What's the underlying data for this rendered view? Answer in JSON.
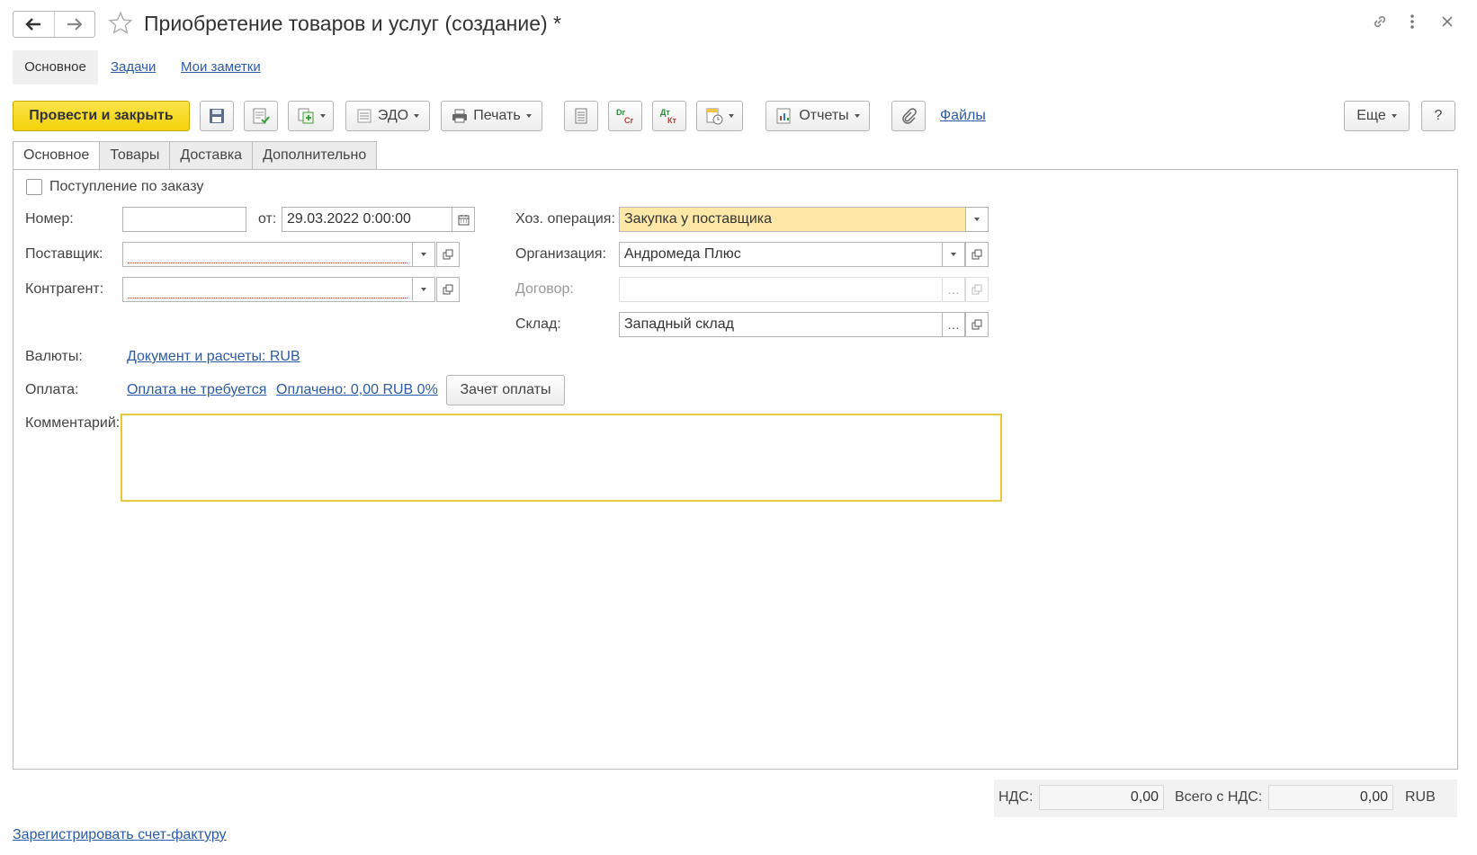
{
  "window": {
    "title": "Приобретение товаров и услуг (создание) *"
  },
  "section_tabs": [
    "Основное",
    "Задачи",
    "Мои заметки"
  ],
  "toolbar": {
    "post_close": "Провести и закрыть",
    "edo": "ЭДО",
    "print": "Печать",
    "reports": "Отчеты",
    "files": "Файлы",
    "more": "Еще",
    "help": "?",
    "dr_cr": "Dr Cr",
    "dt_kt": "Дт Кт"
  },
  "tabs": [
    "Основное",
    "Товары",
    "Доставка",
    "Дополнительно"
  ],
  "form": {
    "by_order_label": "Поступление по заказу",
    "number_label": "Номер:",
    "number_value": "",
    "date_from_label": "от:",
    "date_value": "29.03.2022  0:00:00",
    "supplier_label": "Поставщик:",
    "supplier_value": "",
    "counterparty_label": "Контрагент:",
    "counterparty_value": "",
    "operation_label": "Хоз. операция:",
    "operation_value": "Закупка у поставщика",
    "organization_label": "Организация:",
    "organization_value": "Андромеда Плюс",
    "contract_label": "Договор:",
    "contract_value": "",
    "warehouse_label": "Склад:",
    "warehouse_value": "Западный склад",
    "currency_label": "Валюты:",
    "currency_link": "Документ и расчеты: RUB",
    "payment_label": "Оплата:",
    "payment_not_required": "Оплата не требуется",
    "payment_paid": "Оплачено: 0,00 RUB 0%",
    "payment_offset_button": "Зачет оплаты",
    "comment_label": "Комментарий:",
    "comment_value": ""
  },
  "footer": {
    "vat_label": "НДС:",
    "vat_value": "0,00",
    "total_label": "Всего с НДС:",
    "total_value": "0,00",
    "currency": "RUB",
    "register_invoice": "Зарегистрировать счет-фактуру"
  }
}
